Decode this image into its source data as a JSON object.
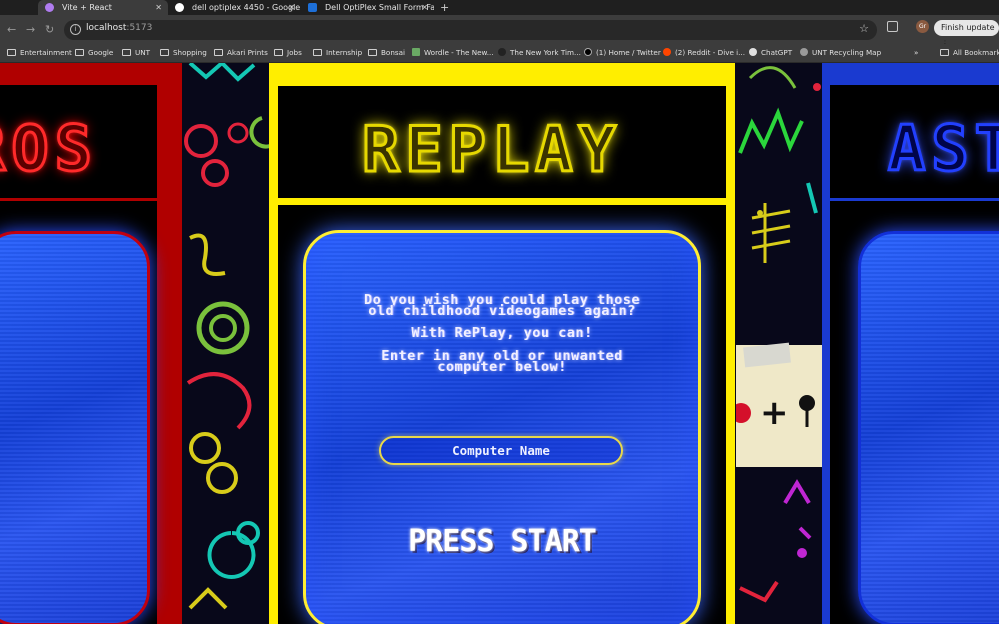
{
  "browser": {
    "tabs": [
      {
        "title": "Vite + React",
        "active": true,
        "favicon_color": "#b07cf0"
      },
      {
        "title": "dell optiplex 4450 - Google S",
        "active": false,
        "favicon_color": "#ffffff"
      },
      {
        "title": "Dell OptiPlex Small Form Fact",
        "active": false,
        "favicon_color": "#1d6fd8"
      }
    ],
    "url_host": "localhost",
    "url_port": ":5173",
    "update_label": "Finish update",
    "profile_initials": "Gr",
    "bookmarks": [
      {
        "label": "Entertainment",
        "type": "folder"
      },
      {
        "label": "Google",
        "type": "folder"
      },
      {
        "label": "UNT",
        "type": "folder"
      },
      {
        "label": "Shopping",
        "type": "folder"
      },
      {
        "label": "Akari Prints",
        "type": "folder"
      },
      {
        "label": "Jobs",
        "type": "folder"
      },
      {
        "label": "Internship",
        "type": "folder"
      },
      {
        "label": "Bonsai",
        "type": "folder"
      },
      {
        "label": "Wordle - The New...",
        "type": "site"
      },
      {
        "label": "The New York Tim...",
        "type": "site"
      },
      {
        "label": "(1) Home / Twitter",
        "type": "site"
      },
      {
        "label": "(2) Reddit - Dive i...",
        "type": "site"
      },
      {
        "label": "ChatGPT",
        "type": "site"
      },
      {
        "label": "UNT Recycling Map",
        "type": "site"
      },
      {
        "label": "All Bookmarks",
        "type": "folder"
      }
    ]
  },
  "page": {
    "left_title": "ROS",
    "center_title": "REPLAY",
    "right_title": "AST",
    "intro_line1": "Do you wish you could play those",
    "intro_line2": "old childhood videogames again?",
    "intro_line3": "With RePlay, you can!",
    "intro_line4": "Enter in any old or unwanted",
    "intro_line5": "computer below!",
    "input_placeholder": "Computer Name",
    "start_label": "PRESS START",
    "sticky_symbol": "+"
  },
  "colors": {
    "left_cabinet": "#b00000",
    "center_cabinet": "#ffee00",
    "right_cabinet": "#1a3ad0",
    "screen_blue": "#1f4cf0"
  }
}
